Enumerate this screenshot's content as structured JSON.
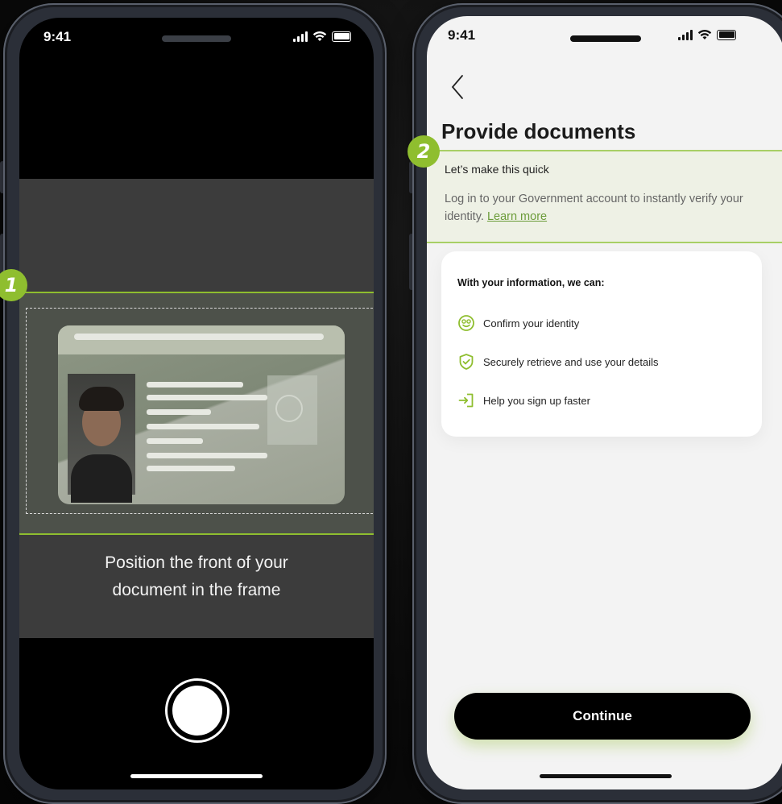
{
  "colors": {
    "accent": "#8fbe2f",
    "link": "#6c9c3a",
    "camera_bg": "#3c3c3c"
  },
  "phone1": {
    "status": {
      "time": "9:41"
    },
    "badge": "1",
    "instruction_line1": "Position the front of your",
    "instruction_line2": "document in the frame"
  },
  "phone2": {
    "status": {
      "time": "9:41"
    },
    "badge": "2",
    "title": "Provide documents",
    "quick": {
      "title": "Let’s make this quick",
      "desc": "Log in to your Government account to instantly verify your identity.",
      "link": "Learn more"
    },
    "card": {
      "title": "With your information, we can:",
      "items": [
        {
          "label": "Confirm your identity",
          "icon": "face-smile-icon"
        },
        {
          "label": "Securely retrieve and use your details",
          "icon": "shield-check-icon"
        },
        {
          "label": "Help you sign up faster",
          "icon": "sign-in-icon"
        }
      ]
    },
    "continue_label": "Continue"
  }
}
